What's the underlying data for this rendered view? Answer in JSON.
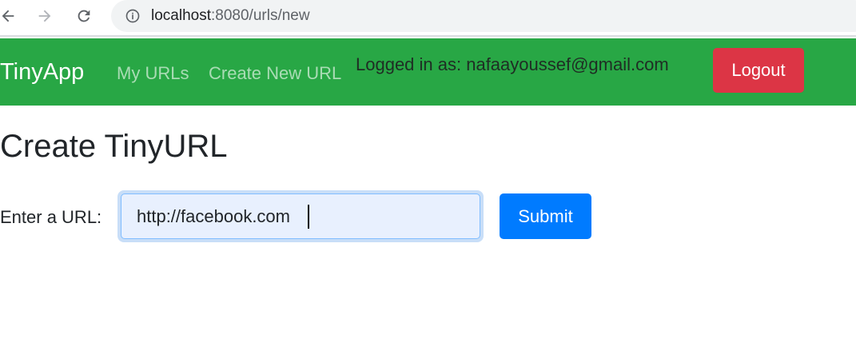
{
  "browser": {
    "url_host": "localhost",
    "url_rest": ":8080/urls/new",
    "icons": {
      "back": "arrow-left-icon",
      "forward": "arrow-right-icon",
      "reload": "reload-icon",
      "info": "info-icon"
    }
  },
  "navbar": {
    "brand": "TinyApp",
    "links": [
      {
        "label": "My URLs"
      },
      {
        "label": "Create New URL"
      }
    ],
    "logged_in_text": "Logged in as: nafaayoussef@gmail.com",
    "logout_label": "Logout",
    "color": "#28a745"
  },
  "main": {
    "title": "Create TinyURL",
    "url_label": "Enter a URL:",
    "url_value": "http://facebook.com",
    "submit_label": "Submit"
  },
  "colors": {
    "logout": "#dc3545",
    "submit": "#007bff"
  }
}
